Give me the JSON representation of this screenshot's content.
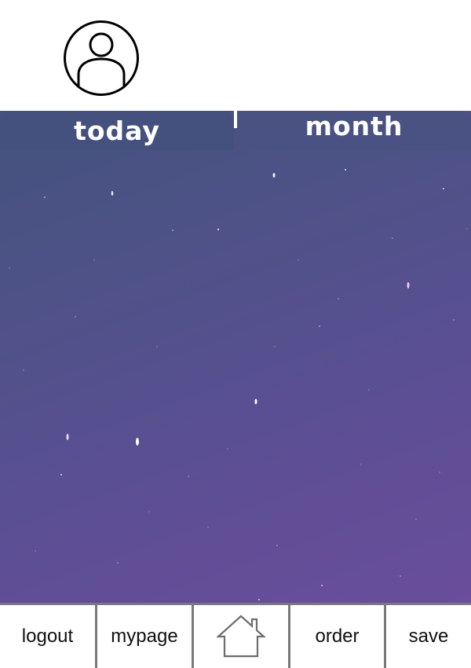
{
  "profile": {
    "avatar_icon": "user-avatar-icon"
  },
  "tabs": [
    {
      "label": "today"
    },
    {
      "label": "month"
    }
  ],
  "bottom_nav": {
    "logout": "logout",
    "mypage": "mypage",
    "home_icon": "home-icon",
    "order": "order",
    "save": "save"
  },
  "colors": {
    "sky_top": "#44527e",
    "sky_bottom": "#6a4d9c",
    "tab_text": "#ffffff",
    "nav_border": "#7a7a7a"
  }
}
